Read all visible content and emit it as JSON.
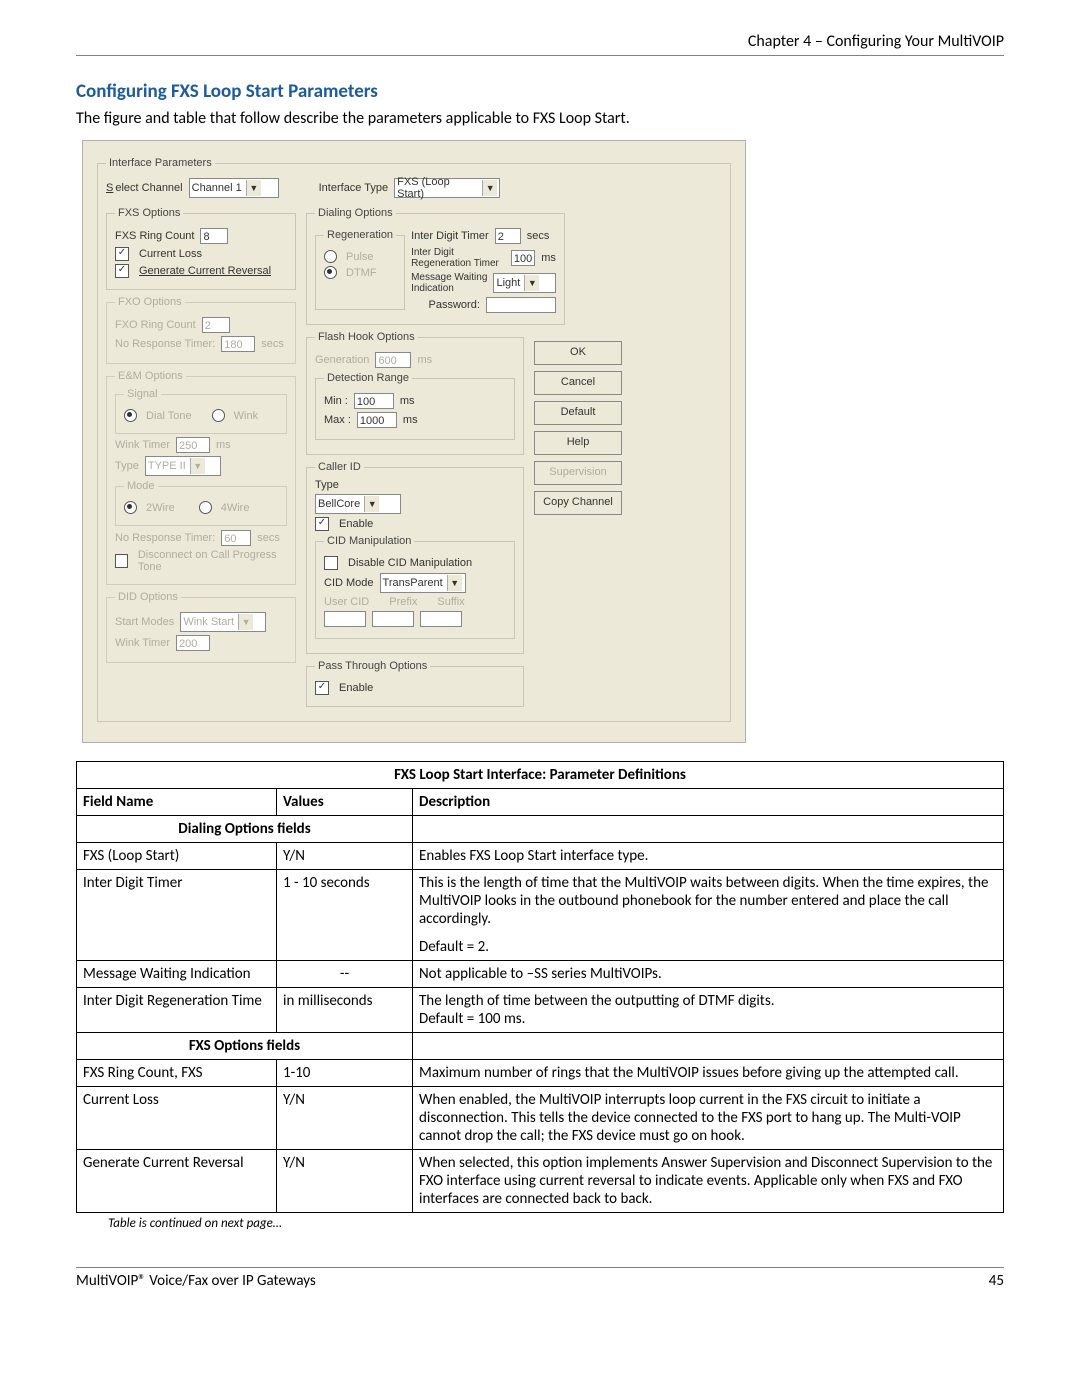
{
  "chapter": "Chapter 4 – Configuring Your MultiVOIP",
  "section_title": "Configuring FXS Loop Start Parameters",
  "intro": "The figure and table that follow describe the parameters applicable to FXS Loop Start.",
  "dialog": {
    "interface_params_legend": "Interface Parameters",
    "select_channel_label": "Select Channel",
    "select_channel_value": "Channel 1",
    "interface_type_label": "Interface Type",
    "interface_type_value": "FXS (Loop Start)",
    "fxs_options": {
      "legend": "FXS Options",
      "ring_count_label": "FXS Ring Count",
      "ring_count_value": "8",
      "current_loss_label": "Current  Loss",
      "gen_cur_rev_label": "Generate Current Reversal"
    },
    "fxo_options": {
      "legend": "FXO Options",
      "ring_count_label": "FXO Ring Count",
      "ring_count_value": "2",
      "no_resp_label": "No Response Timer:",
      "no_resp_value": "180",
      "no_resp_unit": "secs"
    },
    "em_options": {
      "legend": "E&M Options",
      "signal_legend": "Signal",
      "dial_tone": "Dial Tone",
      "wink": "Wink",
      "wink_timer_label": "Wink Timer",
      "wink_timer_value": "250",
      "wink_timer_unit": "ms",
      "type_label": "Type",
      "type_value": "TYPE II",
      "mode_legend": "Mode",
      "mode_2wire": "2Wire",
      "mode_4wire": "4Wire",
      "no_resp2_label": "No Response Timer:",
      "no_resp2_value": "60",
      "no_resp2_unit": "secs",
      "disc_label": "Disconnect on Call Progress Tone"
    },
    "did_options": {
      "legend": "DID Options",
      "start_modes_label": "Start Modes",
      "start_modes_value": "Wink Start",
      "wink_timer_label": "Wink Timer",
      "wink_timer_value": "200"
    },
    "dialing_options": {
      "legend": "Dialing Options",
      "regen_legend": "Regeneration",
      "pulse": "Pulse",
      "dtmf": "DTMF",
      "interdigit_timer_label": "Inter Digit Timer",
      "interdigit_timer_value": "2",
      "interdigit_timer_unit": "secs",
      "interdigit_regen_label": "Inter Digit Regeneration Timer",
      "interdigit_regen_value": "100",
      "interdigit_regen_unit": "ms",
      "mwi_label": "Message Waiting Indication",
      "mwi_value": "Light",
      "pwd_label": "Password:"
    },
    "flash_hook": {
      "legend": "Flash Hook Options",
      "gen_label": "Generation",
      "gen_value": "600",
      "gen_unit": "ms",
      "det_legend": "Detection Range",
      "min_label": "Min :",
      "min_value": "100",
      "max_label": "Max :",
      "max_value": "1000",
      "unit": "ms"
    },
    "caller_id": {
      "legend": "Caller ID",
      "type_label": "Type",
      "type_value": "BellCore",
      "enable_label": "Enable",
      "cid_manip_legend": "CID Manipulation",
      "disable_label": "Disable CID Manipulation",
      "cid_mode_label": "CID Mode",
      "cid_mode_value": "TransParent",
      "user_cid_label": "User CID",
      "prefix_label": "Prefix",
      "suffix_label": "Suffix"
    },
    "pass_through": {
      "legend": "Pass Through Options",
      "enable_label": "Enable"
    },
    "buttons": {
      "ok": "OK",
      "cancel": "Cancel",
      "default": "Default",
      "help": "Help",
      "supervision": "Supervision",
      "copy_channel": "Copy Channel"
    }
  },
  "table": {
    "title": "FXS Loop Start Interface: Parameter Definitions",
    "headers": {
      "field": "Field Name",
      "values": "Values",
      "desc": "Description"
    },
    "group1": "Dialing Options fields",
    "rows1": [
      {
        "f": "FXS (Loop Start)",
        "v": "Y/N",
        "d": "Enables FXS Loop Start interface type."
      },
      {
        "f": "Inter Digit Timer",
        "v": "1 - 10 seconds",
        "d": "This is the length of time that the MultiVOIP waits between digits. When the time expires, the MultiVOIP looks in the outbound phonebook for the number entered and place the call accordingly.",
        "d2": "Default = 2."
      },
      {
        "f": "Message Waiting Indication",
        "v": "--",
        "d": "Not applicable to –SS series MultiVOIPs."
      },
      {
        "f": "Inter Digit Regeneration Time",
        "v": "in milliseconds",
        "d": "The length of time between the outputting of DTMF digits.",
        "d2b": "Default = 100 ms."
      }
    ],
    "group2": "FXS Options fields",
    "rows2": [
      {
        "f": "FXS Ring Count, FXS",
        "v": "1-10",
        "d": "Maximum number of rings that the MultiVOIP issues before giving up the attempted call."
      },
      {
        "f": "Current Loss",
        "v": "Y/N",
        "d": "When enabled, the MultiVOIP interrupts loop current in the FXS circuit to initiate a disconnection. This tells the device connected to the FXS port to hang up. The Multi-VOIP cannot drop the call; the FXS device must go on hook."
      },
      {
        "f": "Generate Current Reversal",
        "v": "Y/N",
        "d": "When selected, this option implements Answer Supervision and Disconnect Supervision to the FXO interface using current reversal to indicate events. Applicable only when FXS and FXO interfaces are connected back to back."
      }
    ],
    "note": "Table is continued on next page…"
  },
  "footer": {
    "left": "MultiVOIP® Voice/Fax over IP Gateways",
    "right": "45"
  }
}
